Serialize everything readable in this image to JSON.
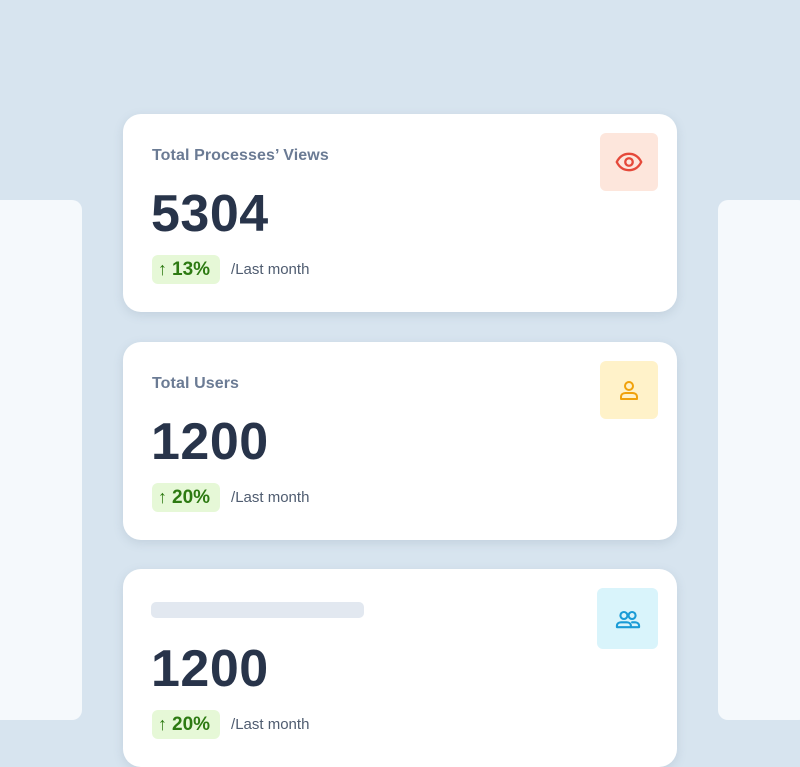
{
  "cards": [
    {
      "title": "Total Processes’ Views",
      "value": "5304",
      "trend": "13%",
      "trend_direction": "up",
      "period": "/Last month",
      "icon": "eye-icon",
      "icon_color": "#e5493a",
      "icon_bg": "#fde6dc"
    },
    {
      "title": "Total Users",
      "value": "1200",
      "trend": "20%",
      "trend_direction": "up",
      "period": "/Last month",
      "icon": "user-icon",
      "icon_color": "#f0a20c",
      "icon_bg": "#fff2c9"
    },
    {
      "title": "",
      "value": "1200",
      "trend": "20%",
      "trend_direction": "up",
      "period": "/Last month",
      "icon": "users-group-icon",
      "icon_color": "#1a9bd6",
      "icon_bg": "#d9f4fb"
    }
  ],
  "trend_up_arrow": "↑",
  "colors": {
    "page_background": "#d7e4ef",
    "card_background": "#ffffff",
    "trend_positive_text": "#2d7a12",
    "trend_positive_bg": "#e6f8d7"
  }
}
